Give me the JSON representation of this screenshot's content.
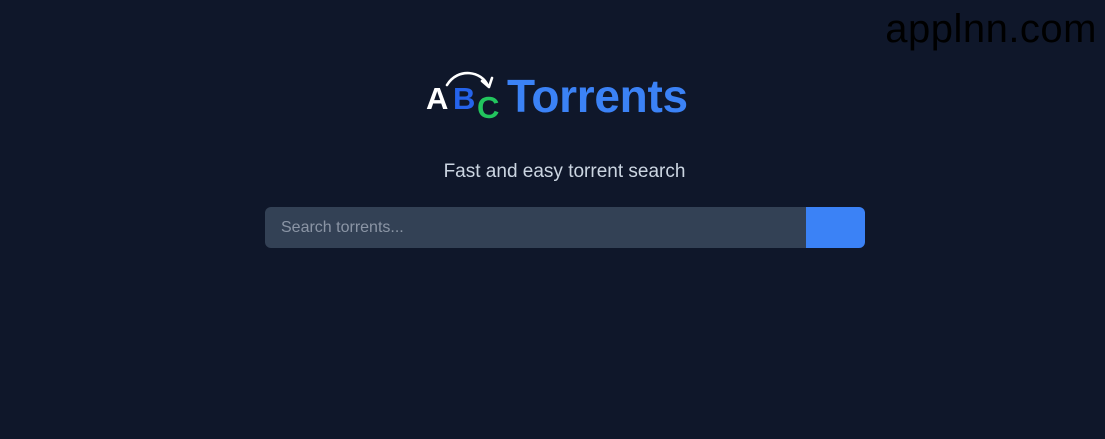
{
  "watermark": "applnn.com",
  "brand": {
    "logo_letters": [
      "A",
      "B",
      "C"
    ],
    "name": "Torrents",
    "color": "#3b82f6"
  },
  "tagline": "Fast and easy torrent search",
  "search": {
    "placeholder": "Search torrents...",
    "value": "",
    "button_label": ""
  },
  "colors": {
    "background": "#0f172a",
    "input_bg": "#334155",
    "accent": "#3b82f6",
    "logo_a": "#ffffff",
    "logo_b": "#2563eb",
    "logo_c": "#22c55e"
  }
}
